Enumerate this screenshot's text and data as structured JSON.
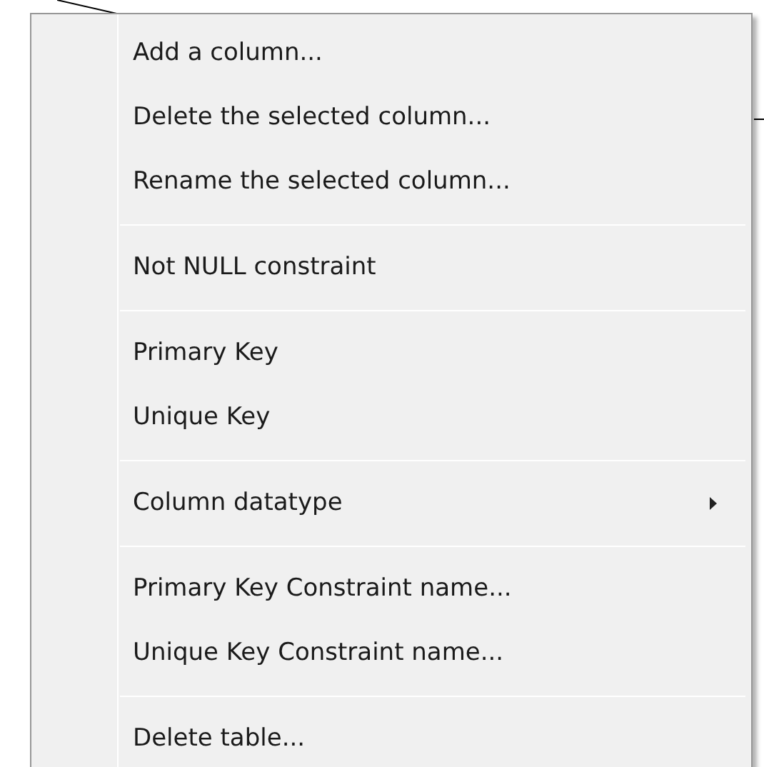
{
  "menu": {
    "groups": [
      {
        "items": [
          {
            "label": "Add a column...",
            "has_submenu": false
          },
          {
            "label": "Delete the selected column...",
            "has_submenu": false
          },
          {
            "label": "Rename the selected column...",
            "has_submenu": false
          }
        ]
      },
      {
        "items": [
          {
            "label": "Not NULL constraint",
            "has_submenu": false
          }
        ]
      },
      {
        "items": [
          {
            "label": "Primary Key",
            "has_submenu": false
          },
          {
            "label": "Unique Key",
            "has_submenu": false
          }
        ]
      },
      {
        "items": [
          {
            "label": "Column datatype",
            "has_submenu": true
          }
        ]
      },
      {
        "items": [
          {
            "label": "Primary Key Constraint name...",
            "has_submenu": false
          },
          {
            "label": "Unique Key Constraint name...",
            "has_submenu": false
          }
        ]
      },
      {
        "items": [
          {
            "label": "Delete table...",
            "has_submenu": false
          }
        ]
      }
    ]
  }
}
